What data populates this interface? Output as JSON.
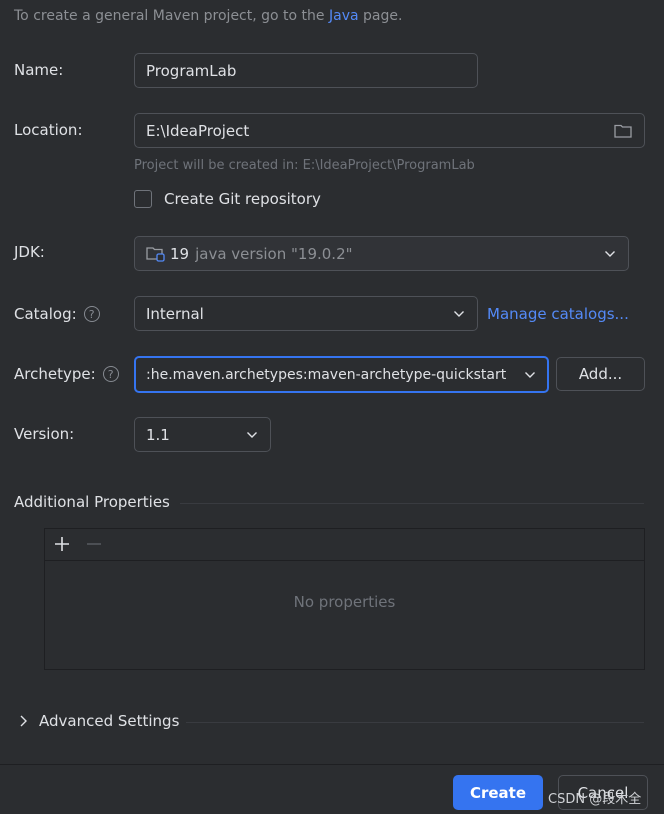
{
  "hint": {
    "prefix": "To create a general Maven project, go to the ",
    "link": "Java",
    "suffix": " page."
  },
  "name": {
    "label": "Name:",
    "value": "ProgramLab"
  },
  "location": {
    "label": "Location:",
    "value": "E:\\IdeaProject",
    "note": "Project will be created in: E:\\IdeaProject\\ProgramLab"
  },
  "git": {
    "label": "Create Git repository",
    "checked": false
  },
  "jdk": {
    "label": "JDK:",
    "version": "19",
    "detail": "java version \"19.0.2\""
  },
  "catalog": {
    "label": "Catalog:",
    "value": "Internal",
    "manage_link": "Manage catalogs..."
  },
  "archetype": {
    "label": "Archetype:",
    "value": ":he.maven.archetypes:maven-archetype-quickstart",
    "add_button": "Add..."
  },
  "version": {
    "label": "Version:",
    "value": "1.1"
  },
  "additional": {
    "title": "Additional Properties",
    "empty_text": "No properties"
  },
  "advanced": {
    "label": "Advanced Settings"
  },
  "footer": {
    "create_button": "Create",
    "cancel_button": "Cancel"
  },
  "watermark": "CSDN @段木全",
  "icons": {
    "help": "question-icon",
    "folder": "folder-icon",
    "jdk": "jdk-folder-icon",
    "add": "plus-icon",
    "remove": "minus-icon",
    "expand": "chevron-right-icon",
    "dropdown": "chevron-down-icon"
  },
  "colors": {
    "accent": "#3574f0",
    "link": "#548af7",
    "background": "#2b2d30"
  }
}
